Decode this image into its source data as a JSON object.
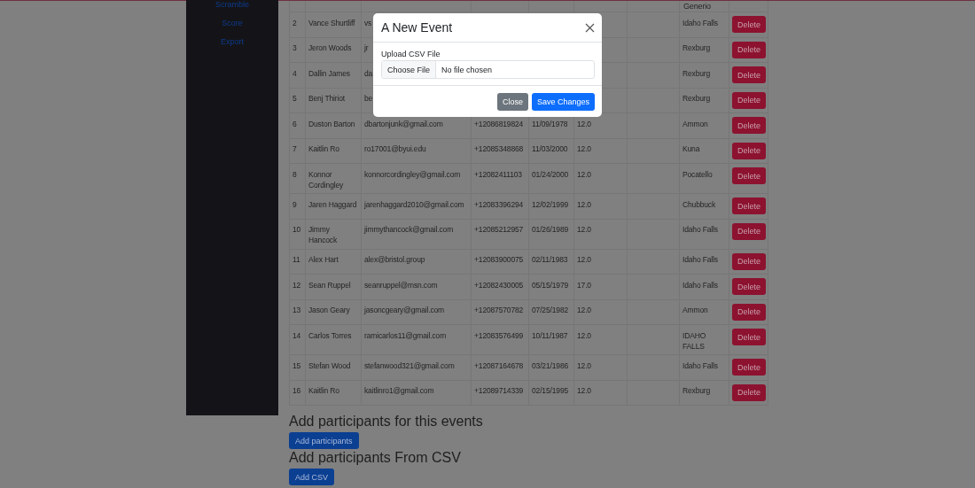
{
  "sidebar": {
    "links": [
      "Scramble",
      "Score",
      "Export"
    ]
  },
  "table": {
    "rows": [
      {
        "city": "Generio"
      },
      {
        "number": "2",
        "name": "Vance Shurtliff",
        "email": "vs",
        "city": "Idaho Falls",
        "action": "Delete"
      },
      {
        "number": "3",
        "name": "Jeron Woods",
        "email": "jr",
        "city": "Rexburg",
        "action": "Delete"
      },
      {
        "number": "4",
        "name": "Dallin James",
        "email": "da",
        "city": "Rexburg",
        "action": "Delete"
      },
      {
        "number": "5",
        "name": "Benj Thiriot",
        "email": "be",
        "city": "Rexburg",
        "action": "Delete"
      },
      {
        "number": "6",
        "name": "Duston Barton",
        "email": "dbartonjunk@gmail.com",
        "phone": "+12086819824",
        "birthdate": "11/09/1978",
        "column_6": "12.0",
        "city": "Ammon",
        "action": "Delete"
      },
      {
        "number": "7",
        "name": "Kaitlin Ro",
        "email": "ro17001@byui.edu",
        "phone": "+12085348868",
        "birthdate": "11/03/2000",
        "column_6": "12.0",
        "city": "Kuna",
        "action": "Delete"
      },
      {
        "number": "8",
        "name": "Konnor Cordingley",
        "email": "konnorcordingley@gmail.com",
        "phone": "+12082411103",
        "birthdate": "01/24/2000",
        "column_6": "12.0",
        "city": "Pocatello",
        "action": "Delete"
      },
      {
        "number": "9",
        "name": "Jaren Haggard",
        "email": "jarenhaggard2010@gmail.com",
        "phone": "+12083396294",
        "birthdate": "12/02/1999",
        "column_6": "12.0",
        "city": "Chubbuck",
        "action": "Delete"
      },
      {
        "number": "10",
        "name": "Jimmy Hancock",
        "email": "jimmythancock@gmail.com",
        "phone": "+12085212957",
        "birthdate": "01/26/1989",
        "column_6": "12.0",
        "city": "Idaho Falls",
        "action": "Delete"
      },
      {
        "number": "11",
        "name": "Alex Hart",
        "email": "alex@bristol.group",
        "phone": "+12083900075",
        "birthdate": "02/11/1983",
        "column_6": "12.0",
        "city": "Idaho Falls",
        "action": "Delete"
      },
      {
        "number": "12",
        "name": "Sean Ruppel",
        "email": "seanruppel@msn.com",
        "phone": "+12082430005",
        "birthdate": "05/15/1979",
        "column_6": "17.0",
        "city": "Idaho Falls",
        "action": "Delete"
      },
      {
        "number": "13",
        "name": "Jason Geary",
        "email": "jasoncgeary@gmail.com",
        "phone": "+12087570782",
        "birthdate": "07/25/1982",
        "column_6": "12.0",
        "city": "Ammon",
        "action": "Delete"
      },
      {
        "number": "14",
        "name": "Carlos Torres",
        "email": "ramicarlos11@gmail.com",
        "phone": "+12083576499",
        "birthdate": "10/11/1987",
        "column_6": "12.0",
        "city": "IDAHO FALLS",
        "action": "Delete"
      },
      {
        "number": "15",
        "name": "Stefan Wood",
        "email": "stefanwood321@gmail.com",
        "phone": "+12087164678",
        "birthdate": "03/21/1986",
        "column_6": "12.0",
        "city": "Idaho Falls",
        "action": "Delete"
      },
      {
        "number": "16",
        "name": "Kaitlin Ro",
        "email": "kaitlinro1@gmail.com",
        "phone": "+12089714339",
        "birthdate": "02/15/1995",
        "column_6": "12.0",
        "city": "Rexburg",
        "action": "Delete"
      }
    ]
  },
  "sections": [
    {
      "heading": "Add participants for this events",
      "button": "Add participants"
    },
    {
      "heading": "Add participants From CSV",
      "button": "Add CSV"
    }
  ],
  "modal": {
    "title": "A New Event",
    "field_label": "Upload CSV File",
    "file_button": "Choose File",
    "file_status": "No file chosen",
    "buttons": [
      {
        "label": "Close",
        "kind": "secondary"
      },
      {
        "label": "Save Changes",
        "kind": "primary"
      }
    ]
  }
}
